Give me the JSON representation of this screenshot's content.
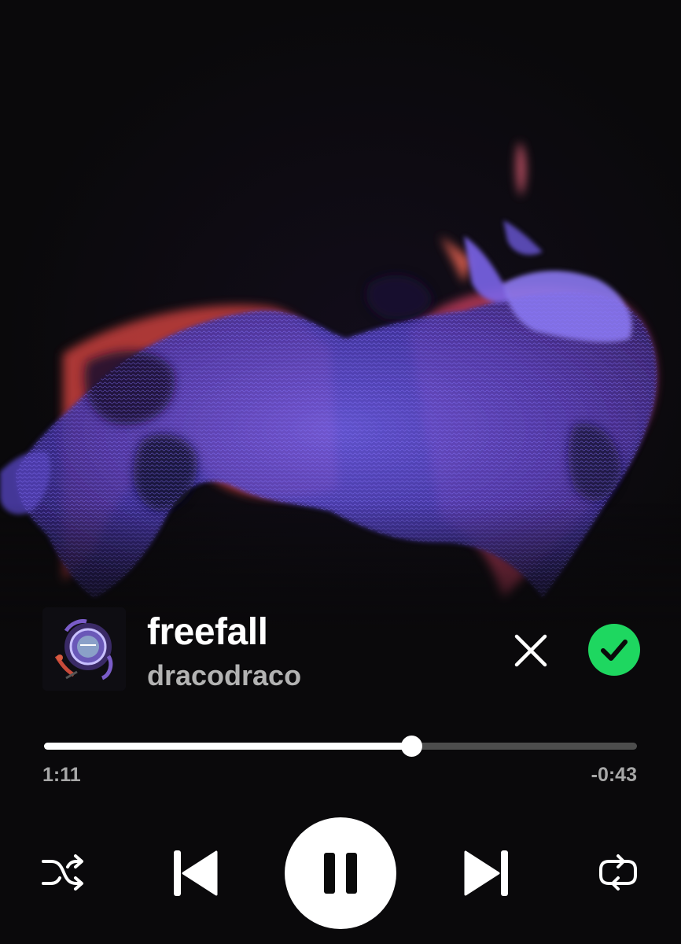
{
  "track": {
    "title": "freefall",
    "artist": "dracodraco"
  },
  "playback": {
    "elapsed": "1:11",
    "remaining": "-0:43",
    "progress_fraction": 0.62,
    "state": "playing"
  },
  "actions": {
    "dismiss_icon": "close-icon",
    "added_icon": "check-circle-icon"
  },
  "controls": {
    "shuffle_icon": "shuffle-icon",
    "previous_icon": "skip-previous-icon",
    "play_pause_icon": "pause-icon",
    "next_icon": "skip-next-icon",
    "repeat_icon": "repeat-icon"
  },
  "colors": {
    "background": "#0a090b",
    "accent_green": "#1ed760",
    "progress_filled": "#ffffff",
    "progress_empty": "#4d4d4d",
    "secondary_text": "#b3b3b3",
    "canvas_purple": "#5a46c8",
    "canvas_red_edge": "#e0504a"
  }
}
